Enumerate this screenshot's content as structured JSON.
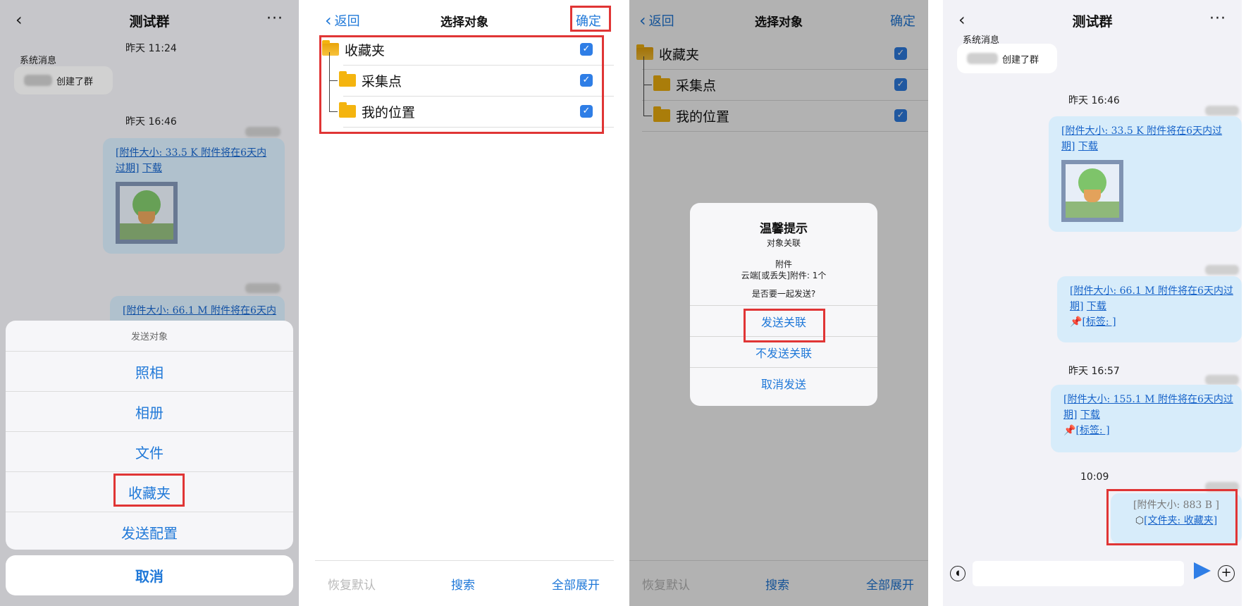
{
  "colors": {
    "accent": "#1f78d8",
    "highlight": "#e03535",
    "bubble": "#d7ecfa"
  },
  "panel1": {
    "title": "测试群",
    "back_icon": "chevron-left",
    "more_icon": "ellipsis",
    "time1": "昨天 11:24",
    "sys_name": "系统消息",
    "sys_text": "创建了群",
    "time2": "昨天 16:46",
    "msg1": {
      "bracket_open": "[",
      "link": "附件大小: 33.5 K 附件将在6天内过期",
      "bracket_close": "]",
      "download": "下载"
    },
    "msg2": {
      "bracket_open": "[",
      "link": "附件大小: 66.1 M 附件将在6天内"
    },
    "sheet": {
      "title": "发送对象",
      "items": [
        "照相",
        "相册",
        "文件",
        "收藏夹",
        "发送配置"
      ],
      "cancel": "取消"
    }
  },
  "panel2": {
    "back": "返回",
    "title": "选择对象",
    "confirm": "确定",
    "tree": [
      {
        "label": "收藏夹",
        "checked": true
      },
      {
        "label": "采集点",
        "checked": true
      },
      {
        "label": "我的位置",
        "checked": true
      }
    ],
    "bottom": {
      "reset": "恢复默认",
      "search": "搜索",
      "expand": "全部展开"
    }
  },
  "panel3": {
    "back": "返回",
    "title": "选择对象",
    "confirm": "确定",
    "tree": [
      {
        "label": "收藏夹",
        "checked": true
      },
      {
        "label": "采集点",
        "checked": true
      },
      {
        "label": "我的位置",
        "checked": true
      }
    ],
    "dialog": {
      "title": "温馨提示",
      "subtitle": "对象关联",
      "line1": "附件",
      "line2": "云端[或丢失]附件: 1个",
      "question": "是否要一起发送?",
      "btn_send_related": "发送关联",
      "btn_send_without": "不发送关联",
      "btn_cancel": "取消发送"
    },
    "bottom": {
      "reset": "恢复默认",
      "search": "搜索",
      "expand": "全部展开"
    }
  },
  "panel4": {
    "title": "测试群",
    "sys_name": "系统消息",
    "sys_text": "创建了群",
    "time1": "昨天 16:46",
    "msg1": {
      "bracket_open": "[",
      "link": "附件大小: 33.5 K 附件将在6天内过期",
      "bracket_close": "]",
      "download": "下载"
    },
    "msg2": {
      "bracket_open": "[",
      "link": "附件大小: 66.1 M 附件将在6天内过期",
      "bracket_close": "]",
      "download": "下载",
      "tag": "[标签: ]"
    },
    "time2": "昨天 16:57",
    "msg3": {
      "bracket_open": "[",
      "link": "附件大小: 155.1 M 附件将在6天内过期",
      "bracket_close": "]",
      "download": "下载",
      "tag": "[标签: ]"
    },
    "time3": "10:09",
    "msg4": {
      "size": "[附件大小: 883 B ]",
      "folder": "[文件夹: 收藏夹]"
    }
  }
}
